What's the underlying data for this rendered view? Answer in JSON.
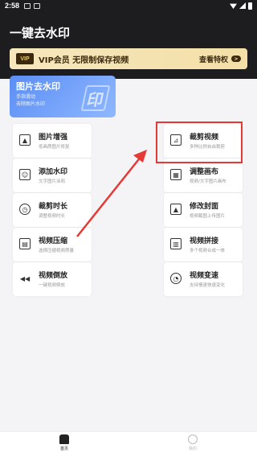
{
  "status_bar": {
    "time": "2:58"
  },
  "header": {
    "title": "一键去水印"
  },
  "vip_banner": {
    "badge": "VIP",
    "text": "VIP会员 无限制保存视频",
    "link": "查看特权",
    "arrow": ">"
  },
  "hero": {
    "title": "图片去水印",
    "line1": "手指滑动",
    "line2": "去除图片水印"
  },
  "tools_left": [
    {
      "name": "图片增强",
      "desc": "低画质图片修复",
      "icon": "image-enhance-icon",
      "glyph": "▲"
    },
    {
      "name": "添加水印",
      "desc": "文字图片涂鸦",
      "icon": "add-watermark-icon",
      "glyph": "☺"
    },
    {
      "name": "裁剪时长",
      "desc": "调整视频时长",
      "icon": "trim-duration-icon",
      "glyph": "◷"
    },
    {
      "name": "视频压缩",
      "desc": "选择压缩视频质量",
      "icon": "video-compress-icon",
      "glyph": "▤"
    },
    {
      "name": "视频倒放",
      "desc": "一键视频倒放",
      "icon": "video-reverse-icon",
      "glyph": "◀◀"
    }
  ],
  "tools_right": [
    {
      "name": "裁剪视频",
      "desc": "多种比例自由裁剪",
      "icon": "crop-video-icon",
      "glyph": "⊿"
    },
    {
      "name": "调整画布",
      "desc": "视频/文字图片画布",
      "icon": "adjust-canvas-icon",
      "glyph": "▦"
    },
    {
      "name": "修改封面",
      "desc": "视频截图上传图片",
      "icon": "edit-cover-icon",
      "glyph": "▲"
    },
    {
      "name": "视频拼接",
      "desc": "多个视频合成一体",
      "icon": "video-merge-icon",
      "glyph": "▥"
    },
    {
      "name": "视频变速",
      "desc": "支持慢速快速变化",
      "icon": "video-speed-icon",
      "glyph": "◔"
    }
  ],
  "tabbar": {
    "home": "首页",
    "me": "我的"
  },
  "colors": {
    "header": "#1d1d1f",
    "highlight": "#e53935",
    "vip": "#f3dfa7"
  }
}
